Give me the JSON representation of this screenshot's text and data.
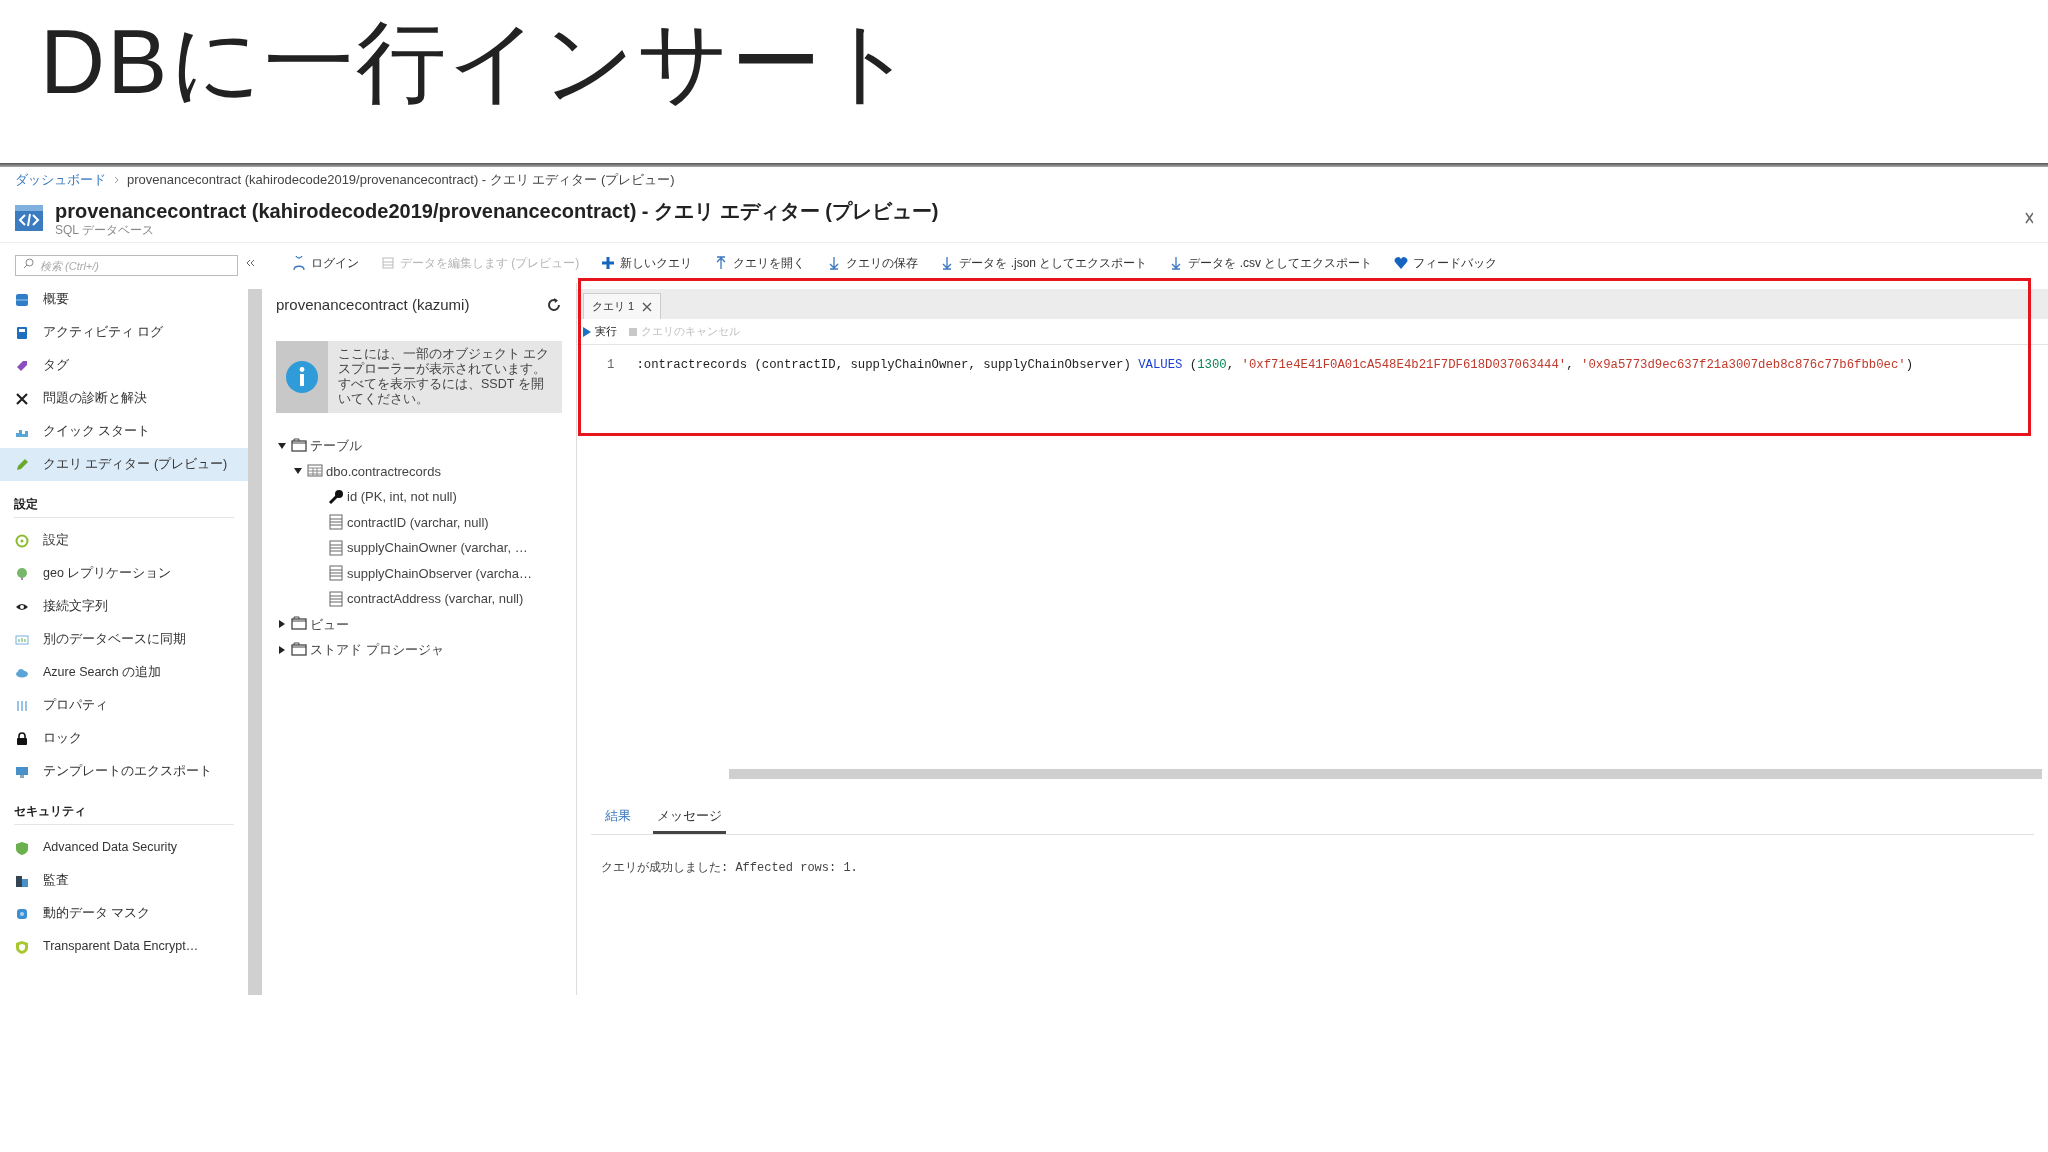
{
  "slide_title": "DBに一行インサート",
  "breadcrumb": [
    {
      "label": "ダッシュボード",
      "link": true
    },
    {
      "label": "provenancecontract (kahirodecode2019/provenancecontract) - クエリ エディター (プレビュー)",
      "link": false
    }
  ],
  "header": {
    "title": "provenancecontract (kahirodecode2019/provenancecontract) - クエリ エディター (プレビュー)",
    "subtitle": "SQL データベース"
  },
  "search": {
    "placeholder": "検索 (Ctrl+/)"
  },
  "toolbar": [
    {
      "label": "ログイン",
      "disabled": false
    },
    {
      "label": "データを編集します (プレビュー)",
      "disabled": true
    },
    {
      "label": "新しいクエリ",
      "disabled": false
    },
    {
      "label": "クエリを開く",
      "disabled": false
    },
    {
      "label": "クエリの保存",
      "disabled": false
    },
    {
      "label": "データを .json としてエクスポート",
      "disabled": false
    },
    {
      "label": "データを .csv としてエクスポート",
      "disabled": false
    },
    {
      "label": "フィードバック",
      "disabled": false
    }
  ],
  "sidebar": [
    {
      "items": [
        {
          "label": "概要",
          "selected": false
        },
        {
          "label": "アクティビティ ログ",
          "selected": false
        },
        {
          "label": "タグ",
          "selected": false
        },
        {
          "label": "問題の診断と解決",
          "selected": false
        },
        {
          "label": "クイック スタート",
          "selected": false
        },
        {
          "label": "クエリ エディター (プレビュー)",
          "selected": true
        }
      ]
    },
    {
      "heading": "設定",
      "items": [
        {
          "label": "設定",
          "selected": false
        },
        {
          "label": "geo レプリケーション",
          "selected": false
        },
        {
          "label": "接続文字列",
          "selected": false
        },
        {
          "label": "別のデータベースに同期",
          "selected": false
        },
        {
          "label": "Azure Search の追加",
          "selected": false
        },
        {
          "label": "プロパティ",
          "selected": false
        },
        {
          "label": "ロック",
          "selected": false
        },
        {
          "label": "テンプレートのエクスポート",
          "selected": false
        }
      ]
    },
    {
      "heading": "セキュリティ",
      "items": [
        {
          "label": "Advanced Data Security",
          "selected": false
        },
        {
          "label": "監査",
          "selected": false
        },
        {
          "label": "動的データ マスク",
          "selected": false
        },
        {
          "label": "Transparent Data Encrypt…",
          "selected": false
        }
      ]
    }
  ],
  "explorer": {
    "connection": "provenancecontract (kazumi)",
    "info": "ここには、一部のオブジェクト エクスプローラーが表示されています。すべてを表示するには、SSDT を開いてください。",
    "tree": [
      {
        "kind": "folder",
        "label": "テーブル",
        "expanded": true,
        "children": [
          {
            "kind": "table",
            "label": "dbo.contractrecords",
            "expanded": true,
            "children": [
              {
                "kind": "key",
                "label": "id (PK, int, not null)"
              },
              {
                "kind": "column",
                "label": "contractID (varchar, null)"
              },
              {
                "kind": "column",
                "label": "supplyChainOwner (varchar, …"
              },
              {
                "kind": "column",
                "label": "supplyChainObserver (varcha…"
              },
              {
                "kind": "column",
                "label": "contractAddress (varchar, null)"
              }
            ]
          }
        ]
      },
      {
        "kind": "folder",
        "label": "ビュー",
        "expanded": false
      },
      {
        "kind": "folder",
        "label": "ストアド プロシージャ",
        "expanded": false
      }
    ]
  },
  "query_tab": {
    "label": "クエリ 1"
  },
  "run_button": {
    "label": "実行"
  },
  "cancel_button": {
    "label": "クエリのキャンセル",
    "disabled": true
  },
  "editor": {
    "line_number": "1",
    "tokens": [
      {
        "kind": "plain",
        "text": ":ontractrecords (contractID, supplyChainOwner, supplyChainObserver) "
      },
      {
        "kind": "keyword",
        "text": "VALUES"
      },
      {
        "kind": "plain",
        "text": " ("
      },
      {
        "kind": "number",
        "text": "1300"
      },
      {
        "kind": "plain",
        "text": ", "
      },
      {
        "kind": "string",
        "text": "'0xf71e4E41F0A01cA548E4b21F7DF618D037063444'"
      },
      {
        "kind": "plain",
        "text": ", "
      },
      {
        "kind": "string",
        "text": "'0x9a5773d9ec637f21a3007deb8c876c77b6fbb0ec'"
      },
      {
        "kind": "plain",
        "text": ")"
      }
    ]
  },
  "result_tabs": [
    {
      "label": "結果",
      "selected": false
    },
    {
      "label": "メッセージ",
      "selected": true
    }
  ],
  "message": "クエリが成功しました: Affected rows: 1."
}
